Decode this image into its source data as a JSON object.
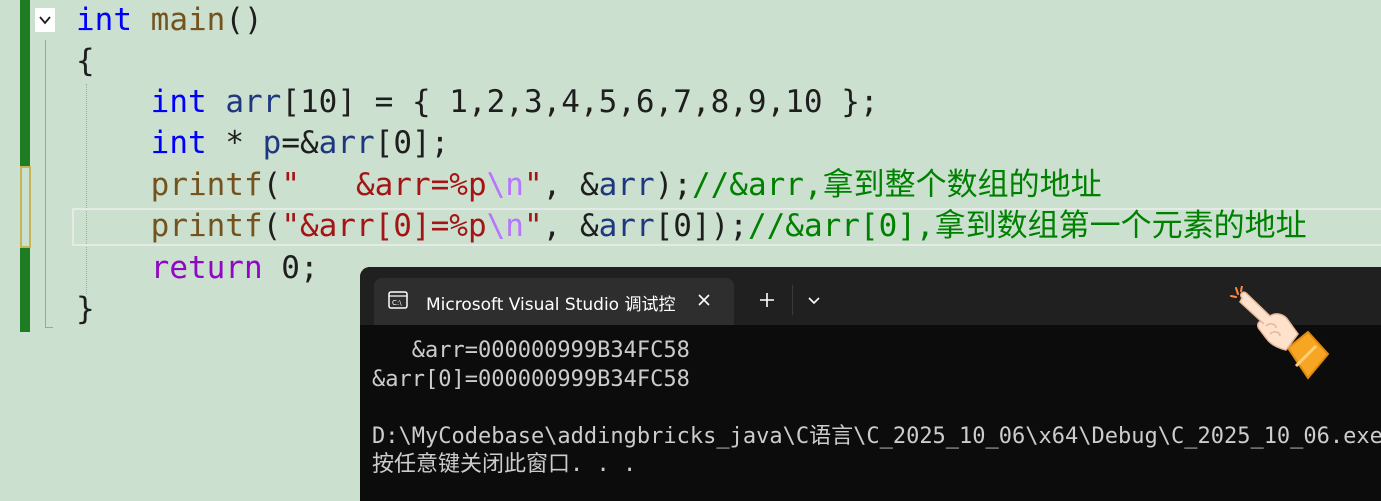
{
  "editor": {
    "lines": [
      [
        {
          "t": "int",
          "c": "kw"
        },
        {
          "t": " ",
          "c": "plain"
        },
        {
          "t": "main",
          "c": "fn"
        },
        {
          "t": "()",
          "c": "plain"
        }
      ],
      [
        {
          "t": "{",
          "c": "plain"
        }
      ],
      [
        {
          "t": "    ",
          "c": "plain"
        },
        {
          "t": "int",
          "c": "kw"
        },
        {
          "t": " ",
          "c": "plain"
        },
        {
          "t": "arr",
          "c": "var"
        },
        {
          "t": "[10] = { 1,2,3,4,5,6,7,8,9,10 };",
          "c": "plain"
        }
      ],
      [
        {
          "t": "    ",
          "c": "plain"
        },
        {
          "t": "int",
          "c": "kw"
        },
        {
          "t": " * ",
          "c": "plain"
        },
        {
          "t": "p",
          "c": "var"
        },
        {
          "t": "=&",
          "c": "plain"
        },
        {
          "t": "arr",
          "c": "var"
        },
        {
          "t": "[0];",
          "c": "plain"
        }
      ],
      [
        {
          "t": "    ",
          "c": "plain"
        },
        {
          "t": "printf",
          "c": "fn"
        },
        {
          "t": "(",
          "c": "plain"
        },
        {
          "t": "\"   &arr=%p",
          "c": "str"
        },
        {
          "t": "\\n",
          "c": "esc"
        },
        {
          "t": "\"",
          "c": "str"
        },
        {
          "t": ", &",
          "c": "plain"
        },
        {
          "t": "arr",
          "c": "var"
        },
        {
          "t": ");",
          "c": "plain"
        },
        {
          "t": "//&arr,拿到整个数组的地址",
          "c": "cmt"
        }
      ],
      [
        {
          "t": "    ",
          "c": "plain"
        },
        {
          "t": "printf",
          "c": "fn"
        },
        {
          "t": "(",
          "c": "plain"
        },
        {
          "t": "\"&arr[0]=%p",
          "c": "str"
        },
        {
          "t": "\\n",
          "c": "esc"
        },
        {
          "t": "\"",
          "c": "str"
        },
        {
          "t": ", &",
          "c": "plain"
        },
        {
          "t": "arr",
          "c": "var"
        },
        {
          "t": "[0]);",
          "c": "plain"
        },
        {
          "t": "//&arr[0],拿到数组第一个元素的地址",
          "c": "cmt"
        }
      ],
      [
        {
          "t": "    ",
          "c": "plain"
        },
        {
          "t": "return",
          "c": "ctl"
        },
        {
          "t": " 0;",
          "c": "plain"
        }
      ],
      [
        {
          "t": "}",
          "c": "plain"
        }
      ]
    ]
  },
  "terminal": {
    "tab_title": "Microsoft Visual Studio 调试控",
    "close_icon": "close-icon",
    "new_tab_icon": "plus-icon",
    "dropdown_icon": "chevron-down-icon",
    "output": [
      "   &arr=000000999B34FC58",
      "&arr[0]=000000999B34FC58",
      "",
      "D:\\MyCodebase\\addingbricks_java\\C语言\\C_2025_10_06\\x64\\Debug\\C_2025_10_06.exe",
      "按任意键关闭此窗口. . ."
    ]
  },
  "colors": {
    "editor_background": "#cce0cf",
    "keyword": "#0000ff",
    "function": "#74531f",
    "control_keyword": "#8f08c4",
    "variable": "#1f377f",
    "string": "#a31515",
    "escape": "#b776fb",
    "comment": "#008000",
    "change_bar": "#1e7d23",
    "terminal_background": "#0c0c0c",
    "terminal_titlebar": "#202020"
  }
}
